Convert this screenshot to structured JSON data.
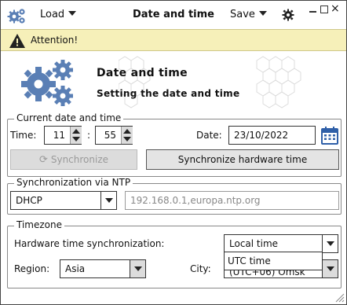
{
  "titlebar": {
    "load_label": "Load",
    "title": "Date and time",
    "save_label": "Save",
    "close_glyph": "×"
  },
  "attention": {
    "text": "Attention!",
    "color": "#f6f0b9"
  },
  "header": {
    "title": "Date and time",
    "subtitle": "Setting the date and time",
    "icon": "gears-icon"
  },
  "current": {
    "legend": "Current date and time",
    "time_label": "Time:",
    "hour": "11",
    "separator": ":",
    "minute": "55",
    "date_label": "Date:",
    "date": "23/10/2022",
    "sync_label": "Synchronize",
    "sync_hw_label": "Synchronize hardware time"
  },
  "ntp": {
    "legend": "Synchronization via NTP",
    "mode": "DHCP",
    "servers": "192.168.0.1,europa.ntp.org"
  },
  "timezone": {
    "legend": "Timezone",
    "hw_sync_label": "Hardware time synchronization:",
    "hw_sync_value": "Local time",
    "hw_sync_options": [
      "UTC time"
    ],
    "region_label": "Region:",
    "region": "Asia",
    "city_label": "City:",
    "city_partial": "(UTC+06) Omsk"
  }
}
